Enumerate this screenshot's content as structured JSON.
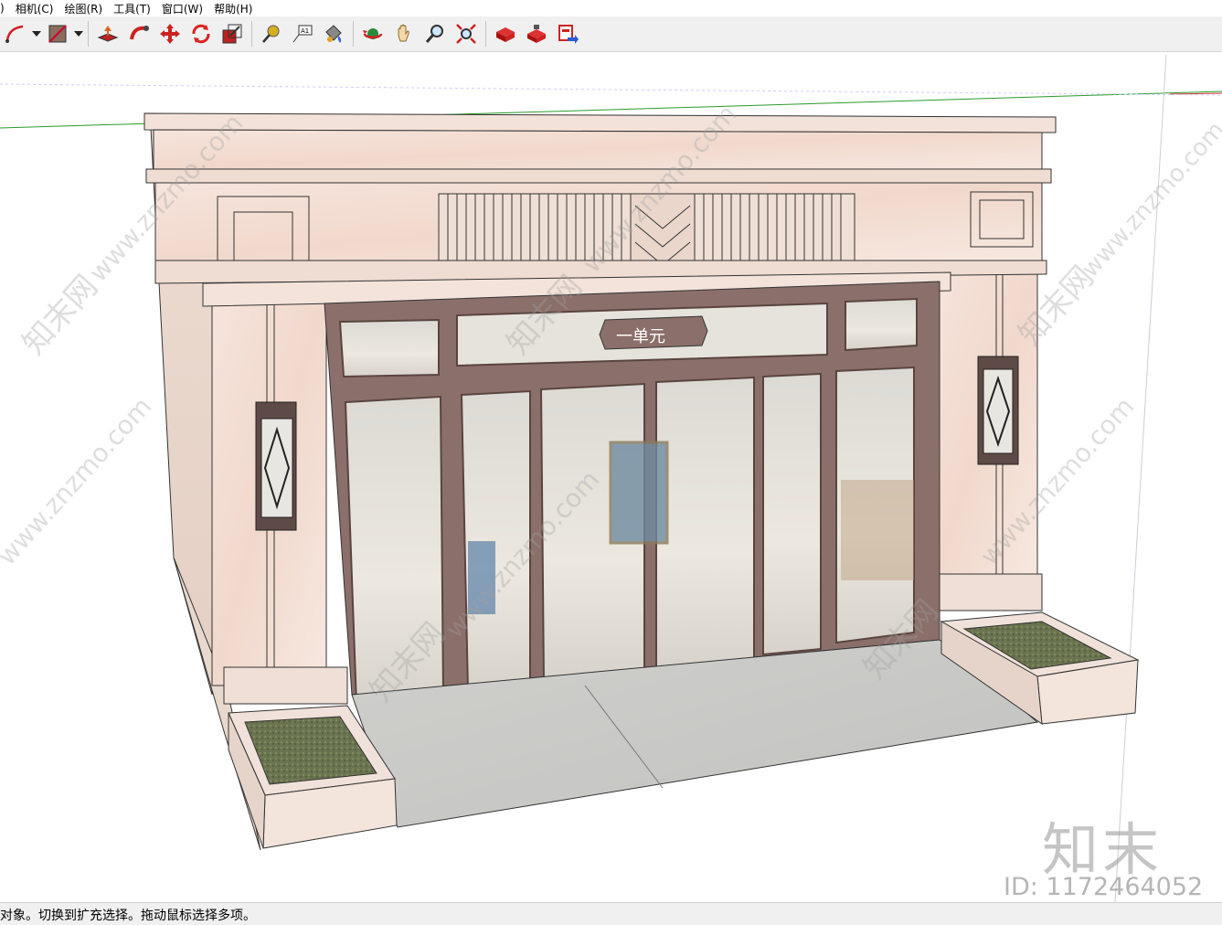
{
  "menu": {
    "items": [
      "相机(C)",
      "绘图(R)",
      "工具(T)",
      "窗口(W)",
      "帮助(H)"
    ],
    "leading": ")"
  },
  "toolbar": {
    "icons": [
      "select-arc-icon",
      "dropdown-icon",
      "eraser-paint-icon",
      "dropdown-icon",
      "push-pull-icon",
      "follow-me-icon",
      "move-icon",
      "rotate-icon",
      "scale-icon",
      "tape-measure-icon",
      "text-icon",
      "paint-bucket-icon",
      "orbit-icon",
      "pan-icon",
      "zoom-icon",
      "zoom-extents-icon",
      "3d-warehouse-icon",
      "extension-warehouse-icon",
      "send-to-layout-icon"
    ]
  },
  "scene": {
    "sign_text": "一单元",
    "watermark_site": "www.znzmo.com",
    "watermark_cn": "知末网"
  },
  "watermark": {
    "logo": "知末",
    "id": "ID: 1172464052"
  },
  "status": {
    "text": "对象。切换到扩充选择。拖动鼠标选择多项。"
  }
}
